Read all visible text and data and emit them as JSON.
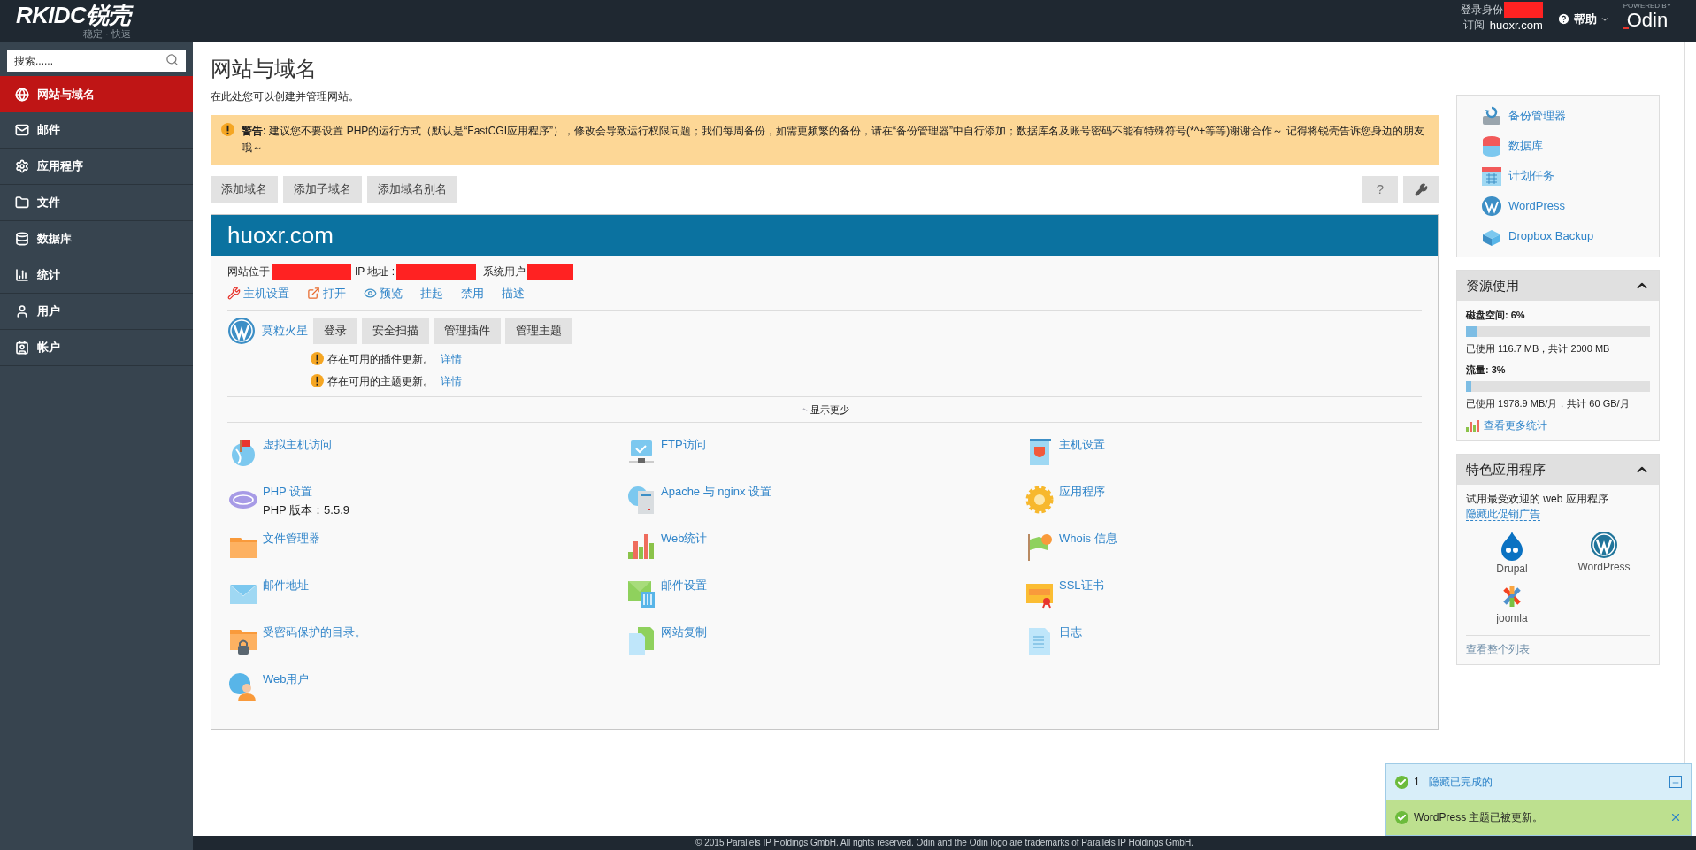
{
  "header": {
    "logo": "RKIDC锐壳",
    "tagline": "稳定 · 快速",
    "login_label": "登录身份",
    "subscription_label": "订阅",
    "subscription": "huoxr.com",
    "help": "帮助",
    "powered_by": "POWERED BY",
    "brand": "Odin"
  },
  "sidebar": {
    "search": {
      "placeholder": "搜索......"
    },
    "items": [
      {
        "label": "网站与域名",
        "selected": true
      },
      {
        "label": "邮件",
        "selected": false
      },
      {
        "label": "应用程序",
        "selected": false
      },
      {
        "label": "文件",
        "selected": false
      },
      {
        "label": "数据库",
        "selected": false
      },
      {
        "label": "统计",
        "selected": false
      },
      {
        "label": "用户",
        "selected": false
      },
      {
        "label": "帐户",
        "selected": false
      }
    ]
  },
  "main": {
    "title": "网站与域名",
    "description": "在此处您可以创建并管理网站。",
    "warning": "**警告:** 建议您不要设置 PHP的运行方式（默认是“FastCGI应用程序”），修改会导致运行权限问题；我们每周备份，如需更频繁的备份，请在“备份管理器”中自行添加；数据库名及账号密码不能有特殊符号(*^+等等)谢谢合作～ 记得将锐壳告诉您身边的朋友哦～",
    "buttons": [
      "添加域名",
      "添加子域名",
      "添加域名别名"
    ],
    "help_button": "?",
    "domain": {
      "name": "huoxr.com",
      "info": [
        "网站位于",
        "IP 地址 :",
        "系统用户"
      ],
      "links": [
        "主机设置",
        "打开",
        "预览",
        "挂起",
        "禁用",
        "描述"
      ],
      "wordpress": {
        "name": "莫粒火星",
        "buttons": [
          "登录",
          "安全扫描",
          "管理插件",
          "管理主题"
        ],
        "notices": [
          {
            "text": "存在可用的插件更新。",
            "link": "详情"
          },
          {
            "text": "存在可用的主题更新。",
            "link": "详情"
          }
        ]
      },
      "show_less": "显示更少",
      "tools": [
        {
          "label": "虚拟主机访问"
        },
        {
          "label": "FTP访问"
        },
        {
          "label": "主机设置"
        },
        {
          "label": "PHP 设置",
          "note": "PHP 版本：5.5.9"
        },
        {
          "label": "Apache 与 nginx 设置"
        },
        {
          "label": "应用程序"
        },
        {
          "label": "文件管理器"
        },
        {
          "label": "Web统计"
        },
        {
          "label": "Whois 信息"
        },
        {
          "label": "邮件地址"
        },
        {
          "label": "邮件设置"
        },
        {
          "label": "SSL证书"
        },
        {
          "label": "受密码保护的目录。"
        },
        {
          "label": "网站复制"
        },
        {
          "label": "日志"
        },
        {
          "label": "Web用户"
        }
      ]
    }
  },
  "right": {
    "quick_links": [
      "备份管理器",
      "数据库",
      "计划任务",
      "WordPress",
      "Dropbox Backup"
    ],
    "resources": {
      "title": "资源使用",
      "expanded": true,
      "meters": [
        {
          "label": "磁盘空间: 6%",
          "level": 0.06,
          "reading": "已使用 116.7 MB，共计 2000 MB"
        },
        {
          "label": "流量: 3%",
          "level": 0.03,
          "reading": "已使用 1978.9 MB/月，共计 60 GB/月"
        }
      ],
      "more": "查看更多统计"
    },
    "featured": {
      "title": "特色应用程序",
      "expanded": true,
      "intro": "试用最受欢迎的 web 应用程序",
      "hide_link": "隐藏此促销广告",
      "apps": [
        "Drupal",
        "WordPress",
        "joomla"
      ],
      "full_list": "查看整个列表"
    }
  },
  "notifications": {
    "count": "1",
    "hide": "隐藏已完成的",
    "messages": [
      "WordPress 主题已被更新。"
    ]
  },
  "footer": "© 2015 Parallels IP Holdings GmbH. All rights reserved. Odin and the Odin logo are trademarks of Parallels IP Holdings GmbH."
}
